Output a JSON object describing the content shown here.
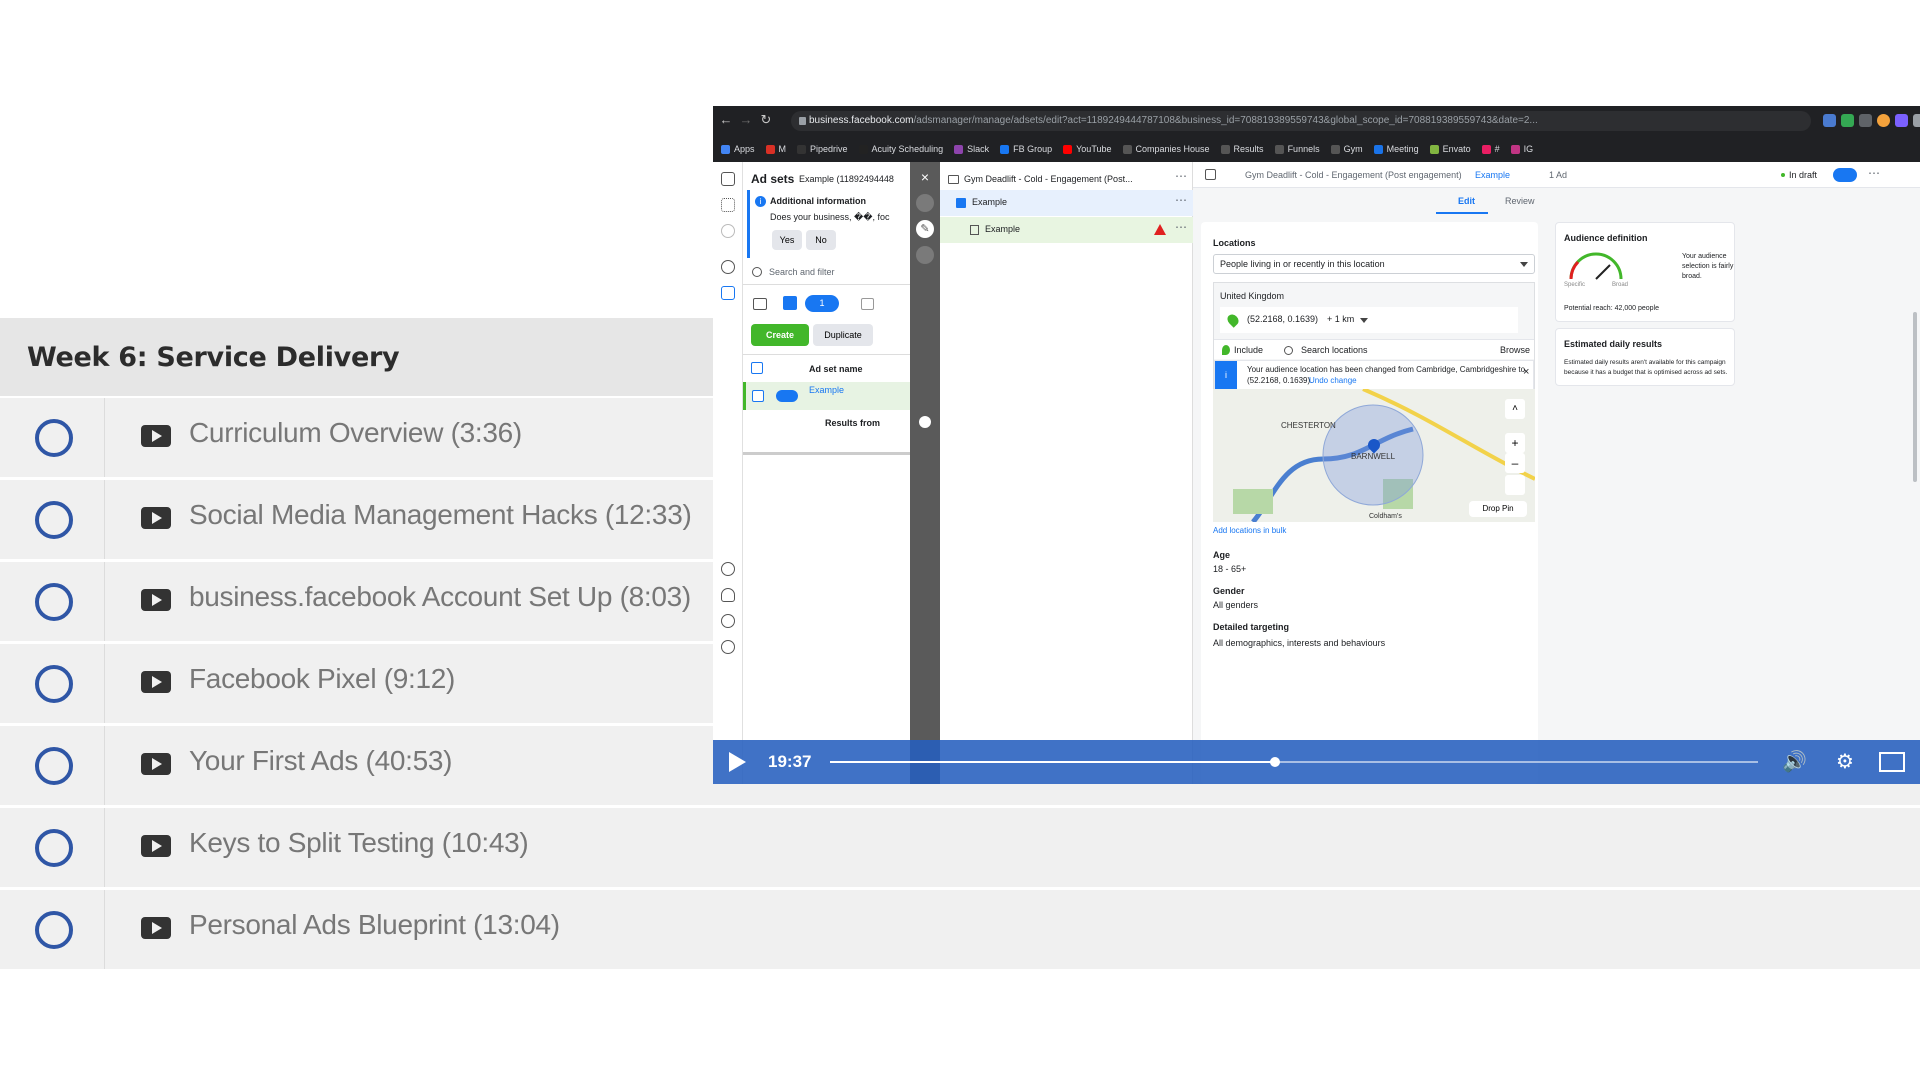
{
  "course": {
    "week_title": "Week 6: Service Delivery",
    "lessons": [
      {
        "title": "Curriculum Overview (3:36)"
      },
      {
        "title": "Social Media Management Hacks (12:33)"
      },
      {
        "title": "business.facebook Account Set Up (8:03)"
      },
      {
        "title": "Facebook Pixel (9:12)"
      },
      {
        "title": "Your First Ads (40:53)"
      },
      {
        "title": "Keys to Split Testing (10:43)"
      },
      {
        "title": "Personal Ads Blueprint (13:04)"
      }
    ]
  },
  "browser": {
    "url_host": "business.facebook.com",
    "url_path": "/adsmanager/manage/adsets/edit?act=1189249444787108&business_id=708819389559743&global_scope_id=708819389559743&date=2...",
    "bookmarks": [
      "Apps",
      "M",
      "Pipedrive",
      "Acuity Scheduling",
      "Slack",
      "FB Group",
      "YouTube",
      "Companies House",
      "Results",
      "Funnels",
      "Gym",
      "Meeting",
      "Envato",
      "#",
      "IG"
    ],
    "bookmark_colors": [
      "#4285f4",
      "#d93025",
      "#333333",
      "#222222",
      "#8e44ad",
      "#1877f2",
      "#ff0000",
      "#555555",
      "#555555",
      "#555555",
      "#555555",
      "#1a73e8",
      "#82b541",
      "#e91e63",
      "#c13584"
    ]
  },
  "adsets_panel": {
    "title": "Ad sets",
    "example_label": "Example (11892494448",
    "info_title": "Additional information",
    "info_text": "Does your business, ��, foc",
    "yes": "Yes",
    "no": "No",
    "search_placeholder": "Search and filter",
    "selected_count": "1",
    "create": "Create",
    "duplicate": "Duplicate",
    "column_name": "Ad set name",
    "row_name": "Example",
    "results_from": "Results from"
  },
  "tree": {
    "campaign": "Gym Deadlift - Cold - Engagement (Post...",
    "adset": "Example",
    "ad": "Example"
  },
  "editor": {
    "breadcrumb_campaign": "Gym Deadlift - Cold - Engagement (Post engagement)",
    "breadcrumb_adset": "Example",
    "breadcrumb_ad": "1 Ad",
    "status": "In draft",
    "tab_edit": "Edit",
    "tab_review": "Review",
    "locations_label": "Locations",
    "locations_select": "People living in or recently in this location",
    "country": "United Kingdom",
    "coords": "(52.2168, 0.1639)",
    "radius": "+ 1 km",
    "include": "Include",
    "search_locations": "Search locations",
    "browse": "Browse",
    "notice": "Your audience location has been changed from Cambridge, Cambridgeshire to",
    "notice2": "(52.2168, 0.1639).",
    "undo": "Undo change",
    "map_label_1": "CHESTERTON",
    "map_label_2": "BARNWELL",
    "map_label_3": "Coldham's",
    "drop_pin": "Drop Pin",
    "add_bulk": "Add locations in bulk",
    "age_label": "Age",
    "age_value": "18 - 65+",
    "gender_label": "Gender",
    "gender_value": "All genders",
    "detailed_label": "Detailed targeting",
    "detailed_value": "All demographics, interests and behaviours"
  },
  "audience": {
    "title": "Audience definition",
    "note": [
      "Your audience",
      "selection is fairly",
      "broad."
    ],
    "specific": "Specific",
    "broad": "Broad",
    "reach": "Potential reach: 42,000 people",
    "est_title": "Estimated daily results",
    "est_text_1": "Estimated daily results aren't available for this campaign",
    "est_text_2": "because it has a budget that is optimised across ad sets."
  },
  "player": {
    "time": "19:37",
    "progress": 0.48
  }
}
